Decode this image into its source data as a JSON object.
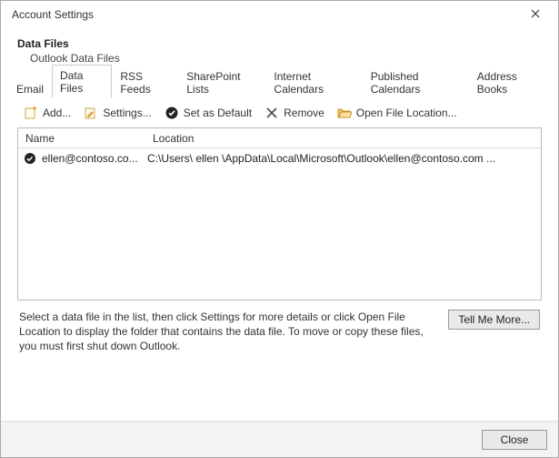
{
  "window": {
    "title": "Account Settings"
  },
  "header": {
    "title": "Data Files",
    "subtitle": "Outlook Data Files"
  },
  "tabs": [
    {
      "label": "Email"
    },
    {
      "label": "Data Files"
    },
    {
      "label": "RSS Feeds"
    },
    {
      "label": "SharePoint Lists"
    },
    {
      "label": "Internet Calendars"
    },
    {
      "label": "Published Calendars"
    },
    {
      "label": "Address Books"
    }
  ],
  "toolbar": {
    "add": "Add...",
    "settings": "Settings...",
    "set_default": "Set as Default",
    "remove": "Remove",
    "open_location": "Open File Location..."
  },
  "columns": {
    "name": "Name",
    "location": "Location"
  },
  "rows": [
    {
      "name": "ellen@contoso.co...",
      "location": "C:\\Users\\   ellen   \\AppData\\Local\\Microsoft\\Outlook\\ellen@contoso.com   ..."
    }
  ],
  "footer": {
    "message": "Select a data file in the list, then click Settings for more details or click Open File Location to display the folder that contains the data file. To move or copy these files, you must first shut down Outlook.",
    "tell_me_more": "Tell Me More...",
    "close": "Close"
  }
}
